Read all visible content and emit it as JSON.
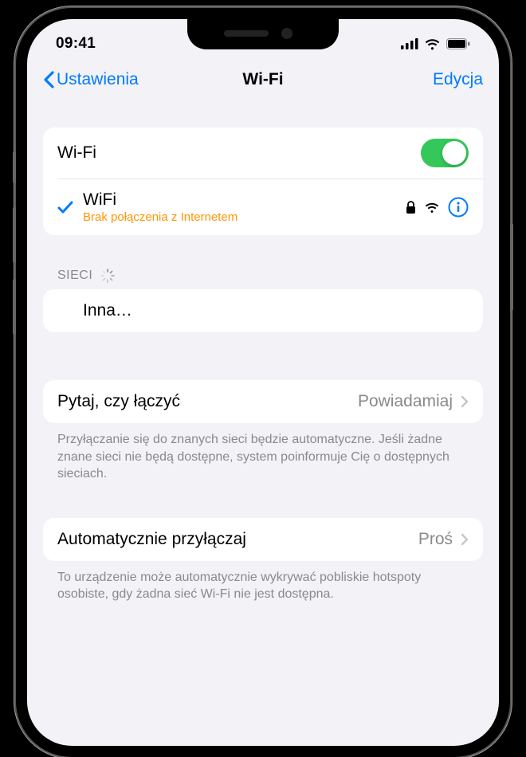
{
  "status": {
    "time": "09:41"
  },
  "nav": {
    "back": "Ustawienia",
    "title": "Wi-Fi",
    "edit": "Edycja"
  },
  "wifi": {
    "label": "Wi-Fi",
    "toggle_on": true,
    "connected": {
      "name": "WiFi",
      "status": "Brak połączenia z Internetem"
    }
  },
  "networks": {
    "header": "SIECI",
    "other": "Inna…"
  },
  "ask_to_join": {
    "label": "Pytaj, czy łączyć",
    "value": "Powiadamiaj",
    "footer": "Przyłączanie się do znanych sieci będzie automatyczne. Jeśli żadne znane sieci nie będą dostępne, system poinformuje Cię o dostępnych sieciach."
  },
  "auto_join": {
    "label": "Automatycznie przyłączaj",
    "value": "Proś",
    "footer": "To urządzenie może automatycznie wykrywać pobliskie hotspoty osobiste, gdy żadna sieć Wi-Fi nie jest dostępna."
  }
}
